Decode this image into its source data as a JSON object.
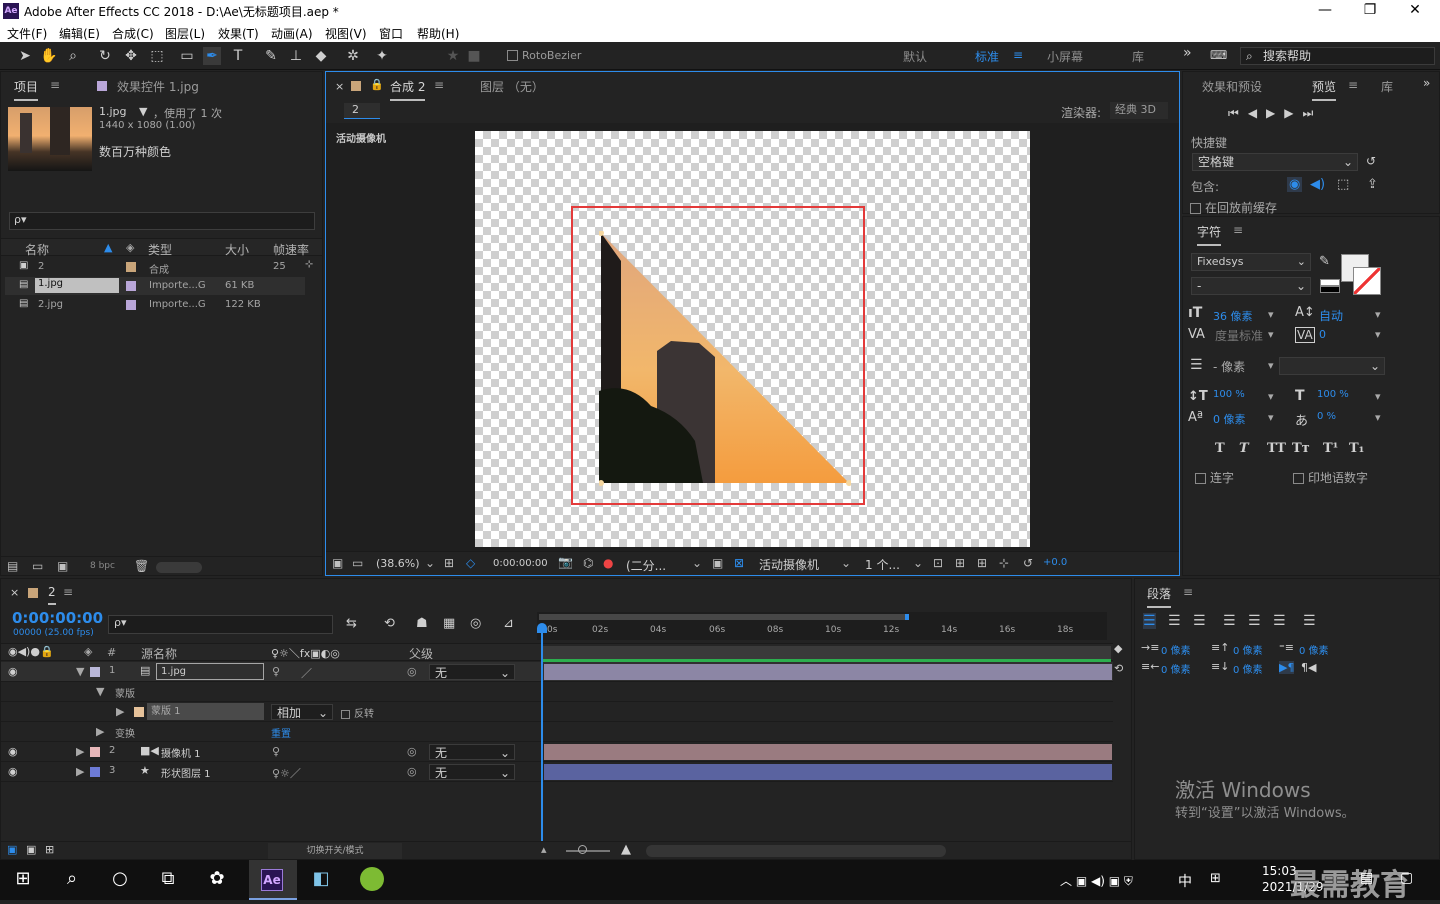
{
  "titlebar": {
    "app_icon": "Ae",
    "title": "Adobe After Effects CC 2018 - D:\\Ae\\无标题项目.aep *",
    "minimize": "—",
    "maximize": "❐",
    "close": "✕"
  },
  "menu": [
    "文件(F)",
    "编辑(E)",
    "合成(C)",
    "图层(L)",
    "效果(T)",
    "动画(A)",
    "视图(V)",
    "窗口",
    "帮助(H)"
  ],
  "toolbar": {
    "rotobezier": "RotoBezier",
    "workspaces": [
      "默认",
      "标准",
      "小屏幕",
      "库"
    ],
    "active_workspace": "标准",
    "search_help": "搜索帮助",
    "more": "»"
  },
  "project": {
    "tabs": [
      "项目",
      "效果控件 1.jpg"
    ],
    "file_name": "1.jpg",
    "usage": "，使用了 1 次",
    "dimensions": "1440 x 1080 (1.00)",
    "color_info": "数百万种颜色",
    "search_placeholder": "ρ▾",
    "columns": [
      "名称",
      "类型",
      "大小",
      "帧速率"
    ],
    "items": [
      {
        "name": "2",
        "type": "合成",
        "size": "",
        "fps": "25",
        "color": "#c9a57a"
      },
      {
        "name": "1.jpg",
        "type": "Importe...G",
        "size": "61 KB",
        "fps": "",
        "color": "#b9a6d8"
      },
      {
        "name": "2.jpg",
        "type": "Importe...G",
        "size": "122 KB",
        "fps": "",
        "color": "#b9a6d8"
      }
    ],
    "bpc": "8 bpc"
  },
  "composition": {
    "tabs": [
      "合成 2",
      "图层 （无）"
    ],
    "comp_name": "2",
    "renderer_label": "渲染器:",
    "renderer": "经典 3D",
    "camera_label": "活动摄像机",
    "footer": {
      "zoom": "(38.6%)",
      "time": "0:00:00:00",
      "resolution": "(二分...",
      "camera": "活动摄像机",
      "views": "1 个...",
      "exposure": "+0.0"
    }
  },
  "preview": {
    "tabs": [
      "效果和预设",
      "预览",
      "库"
    ],
    "shortcut_label": "快捷键",
    "shortcut_value": "空格键",
    "include_label": "包含:",
    "cache_label": "在回放前缓存"
  },
  "character": {
    "tab": "字符",
    "font": "Fixedsys",
    "style": "-",
    "size": "36 像素",
    "leading": "自动",
    "kerning": "度量标准",
    "tracking": "0",
    "stroke": "- 像素",
    "vscale": "100 %",
    "hscale": "100 %",
    "baseline": "0 像素",
    "tsume": "0 %",
    "ligatures": "连字",
    "hindi": "印地语数字",
    "styles": [
      "T",
      "T",
      "TT",
      "Tт",
      "T¹",
      "T₁"
    ]
  },
  "paragraph": {
    "tab": "段落",
    "indent": [
      "0 像素",
      "0 像素",
      "0 像素",
      "0 像素",
      "0 像素"
    ]
  },
  "timeline": {
    "tab": "2",
    "timecode": "0:00:00:00",
    "fps": "00000 (25.00 fps)",
    "columns": [
      "源名称",
      "父级"
    ],
    "ruler": [
      "0s",
      "02s",
      "04s",
      "06s",
      "08s",
      "10s",
      "12s",
      "14s",
      "16s",
      "18s"
    ],
    "layers": [
      {
        "num": "1",
        "name": "1.jpg",
        "parent": "无",
        "color": "#b9b7d8",
        "bar": "#8c86a5"
      },
      {
        "num": "2",
        "name": "摄像机 1",
        "parent": "无",
        "color": "#e7b7b9",
        "bar": "#9a7b80"
      },
      {
        "num": "3",
        "name": "形状图层 1",
        "parent": "无",
        "color": "#6d7bd6",
        "bar": "#5a63a0"
      }
    ],
    "mask_group": "蒙版",
    "mask_name": "蒙版 1",
    "mask_mode": "相加",
    "invert": "反转",
    "transform": "变换",
    "reset": "重置",
    "toggle_label": "切换开关/模式"
  },
  "watermark": {
    "line1": "激活 Windows",
    "line2": "转到“设置”以激活 Windows。",
    "brand": "最需教育"
  },
  "taskbar": {
    "time": "15:03",
    "date": "2021/1/29",
    "ime": "中",
    "ae": "Ae"
  }
}
